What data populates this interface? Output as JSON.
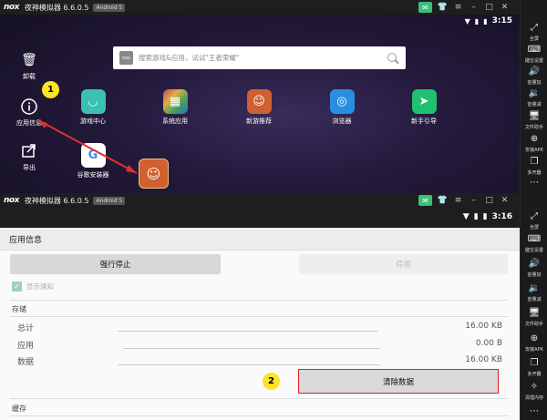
{
  "window": {
    "logo": "nox",
    "app_name": "夜神模拟器 6.6.0.5",
    "android_badge": "Android 5"
  },
  "home": {
    "time": "3:15",
    "search_placeholder": "搜索游戏&应用，试试\"王者荣耀\"",
    "search_logo": "nox",
    "dock": {
      "uninstall": "卸载",
      "app_info": "应用信息",
      "export": "导出"
    },
    "apps": [
      {
        "label": "游戏中心",
        "icon": "nox-game-center-icon",
        "color": "#3ac0b4"
      },
      {
        "label": "系统应用",
        "icon": "system-apps-folder-icon",
        "color": "#c8a050"
      },
      {
        "label": "新游推荐",
        "icon": "new-game-icon",
        "color": "#d06030"
      },
      {
        "label": "浏览器",
        "icon": "browser-icon",
        "color": "#2a8ee0"
      },
      {
        "label": "新手引导",
        "icon": "guide-icon",
        "color": "#20c070"
      },
      {
        "label": "谷歌安装器",
        "icon": "google-installer-icon",
        "color": "#ffffff"
      }
    ],
    "marker1": "1"
  },
  "sidebar": {
    "items": [
      {
        "label": "全屏",
        "icon": "fullscreen-icon"
      },
      {
        "label": "键位设置",
        "icon": "keyboard-icon"
      },
      {
        "label": "音量加",
        "icon": "volume-up-icon"
      },
      {
        "label": "音量减",
        "icon": "volume-down-icon"
      },
      {
        "label": "文件助手",
        "icon": "file-helper-icon"
      },
      {
        "label": "安装APK",
        "icon": "install-apk-icon"
      },
      {
        "label": "多开器",
        "icon": "multi-instance-icon"
      },
      {
        "label": "全屏",
        "icon": "fullscreen-icon"
      },
      {
        "label": "键位设置",
        "icon": "keyboard-icon"
      },
      {
        "label": "音量加",
        "icon": "volume-up-icon"
      },
      {
        "label": "音量减",
        "icon": "volume-down-icon"
      },
      {
        "label": "文件助手",
        "icon": "file-helper-icon"
      },
      {
        "label": "安装APK",
        "icon": "install-apk-icon"
      },
      {
        "label": "多开器",
        "icon": "multi-instance-icon"
      },
      {
        "label": "清理内存",
        "icon": "clean-memory-icon"
      }
    ]
  },
  "appinfo": {
    "time": "3:16",
    "title": "应用信息",
    "force_stop": "强行停止",
    "disable": "停用",
    "show_notifications": "显示通知",
    "storage_header": "存储",
    "storage_rows": [
      {
        "label": "总计",
        "value": "16.00 KB"
      },
      {
        "label": "应用",
        "value": "0.00 B"
      },
      {
        "label": "数据",
        "value": "16.00 KB"
      }
    ],
    "clear_data": "清除数据",
    "cache_header": "缓存",
    "marker2": "2"
  },
  "colors": {
    "annotation_arrow": "#e03030",
    "annotation_marker": "#fce525",
    "highlight_border": "#e02020"
  }
}
